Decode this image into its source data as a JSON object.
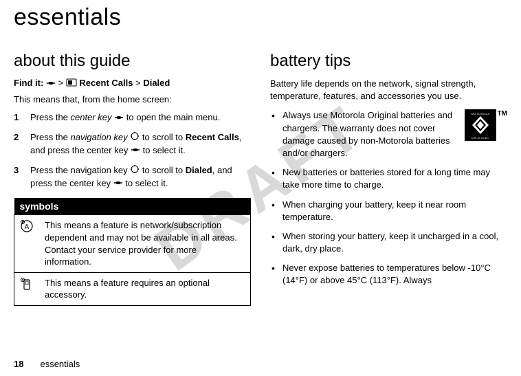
{
  "watermark": "DRAFT",
  "chapter_title": "essentials",
  "left": {
    "section_title": "about this guide",
    "find_it_label": "Find it:",
    "find_it_path_1": "Recent Calls",
    "find_it_path_2": "Dialed",
    "gt": ">",
    "intro": "This means that, from the home screen:",
    "steps": [
      {
        "num": "1",
        "pre": "Press the ",
        "it": "center key",
        "post": " to open the main menu."
      },
      {
        "num": "2",
        "pre": "Press the ",
        "it": "navigation key",
        "mid": " to scroll to ",
        "bold": "Recent Calls",
        "post2": ", and press the center key ",
        "post3": " to select it."
      },
      {
        "num": "3",
        "pre": "Press the navigation key ",
        "mid": " to scroll to ",
        "bold": "Dialed",
        "post2": ", and press the center key ",
        "post3": " to select it."
      }
    ],
    "symbols_header": "symbols",
    "symbol_rows": [
      "This means a feature is network/subscription dependent and may not be available in all areas. Contact your service provider for more information.",
      "This means a feature requires an optional accessory."
    ]
  },
  "right": {
    "section_title": "battery tips",
    "intro": "Battery life depends on the network, signal strength, temperature, features, and accessories you use.",
    "bullets": [
      "Always use Motorola Original batteries and chargers. The warranty does not cover damage caused by non-Motorola batteries and/or chargers.",
      "New batteries or batteries stored for a long time may take more time to charge.",
      "When charging your battery, keep it near room temperature.",
      "When storing your battery, keep it uncharged in a cool, dark, dry place.",
      "Never expose batteries to temperatures below -10°C (14°F) or above 45°C (113°F). Always"
    ],
    "tm": "TM"
  },
  "footer": {
    "page": "18",
    "label": "essentials"
  }
}
